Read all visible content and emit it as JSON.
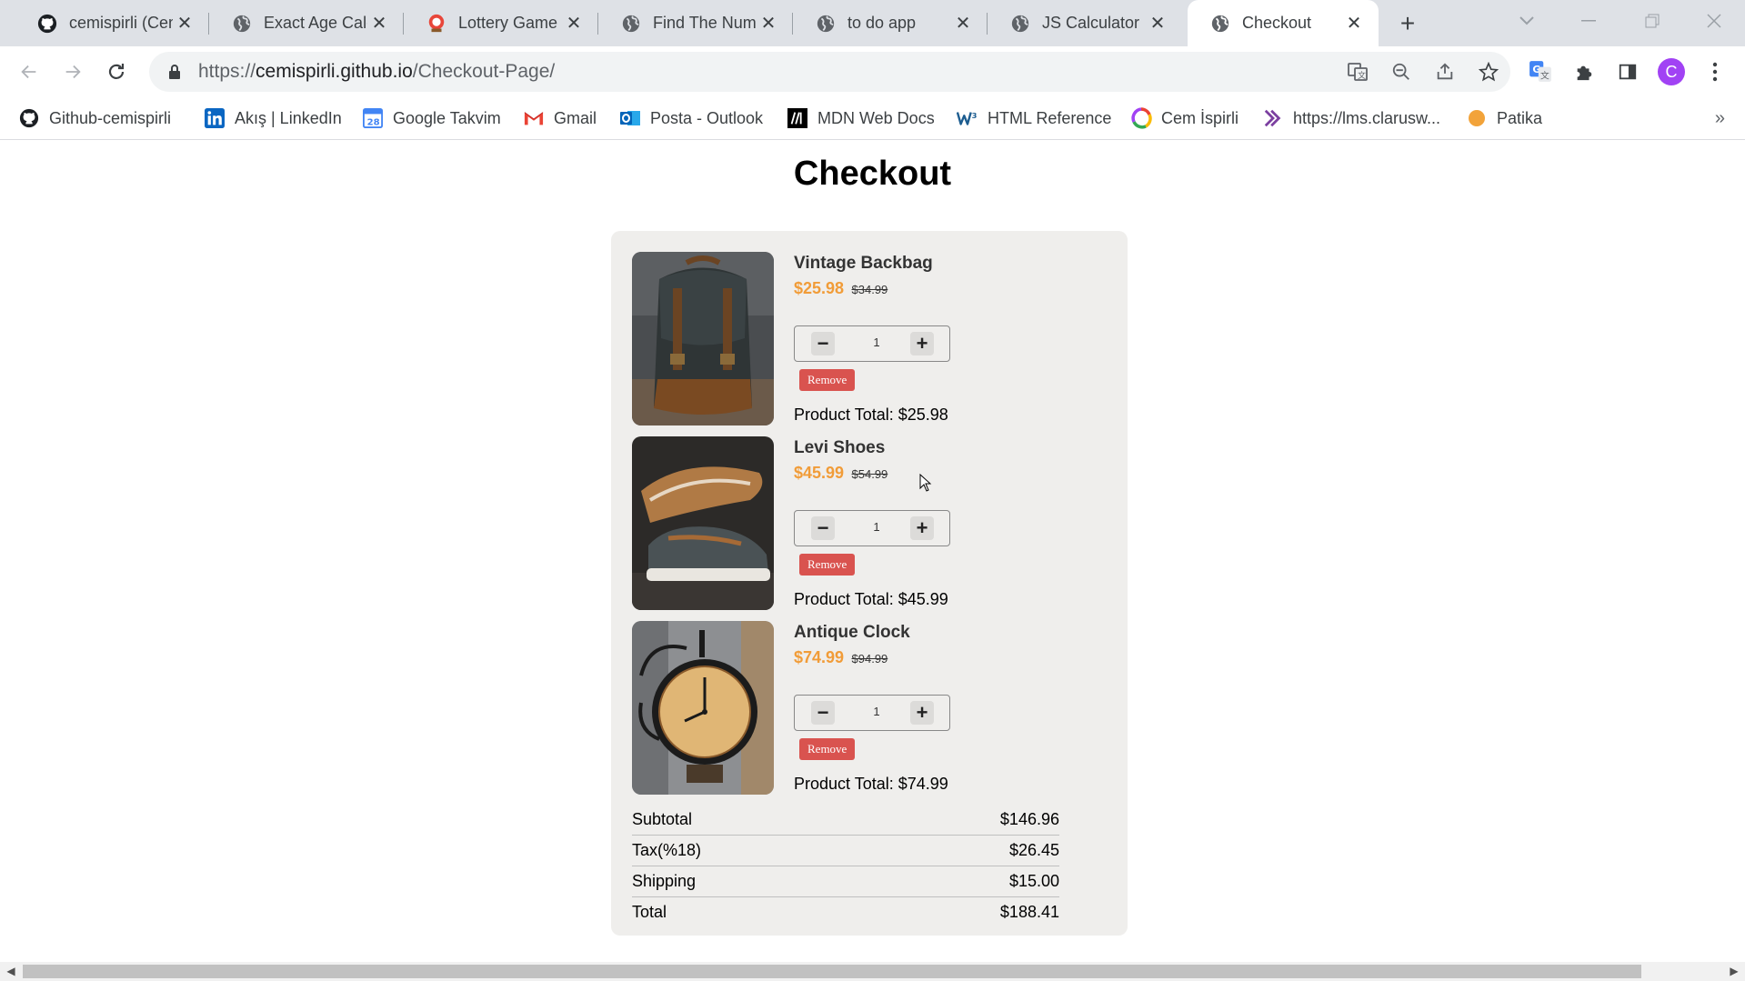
{
  "browser": {
    "tabs": [
      {
        "title": "cemispirli (Cem",
        "icon": "github-icon",
        "active": false
      },
      {
        "title": "Exact Age Calc",
        "icon": "globe-icon",
        "active": false
      },
      {
        "title": "Lottery Game",
        "icon": "lottery-icon",
        "active": false
      },
      {
        "title": "Find The Numb",
        "icon": "globe-icon",
        "active": false
      },
      {
        "title": "to do app",
        "icon": "globe-icon",
        "active": false
      },
      {
        "title": "JS Calculator",
        "icon": "globe-icon",
        "active": false
      },
      {
        "title": "Checkout",
        "icon": "globe-icon",
        "active": true
      }
    ],
    "url": {
      "scheme": "https://",
      "host": "cemispirli.github.io",
      "path": "/Checkout-Page/"
    },
    "avatar_letter": "C",
    "accent": "#a142f4",
    "bookmarks": [
      {
        "label": "Github-cemispirli",
        "icon": "github-icon"
      },
      {
        "label": "Akış | LinkedIn",
        "icon": "linkedin-icon"
      },
      {
        "label": "Google Takvim",
        "icon": "calendar-icon"
      },
      {
        "label": "Gmail",
        "icon": "gmail-icon"
      },
      {
        "label": "Posta - Outlook",
        "icon": "outlook-icon"
      },
      {
        "label": "MDN Web Docs",
        "icon": "mdn-icon"
      },
      {
        "label": "HTML Reference",
        "icon": "w3-icon"
      },
      {
        "label": "Cem İspirli",
        "icon": "swirl-icon"
      },
      {
        "label": "https://lms.clarusw...",
        "icon": "clarusway-icon"
      },
      {
        "label": "Patika",
        "icon": "patika-icon"
      }
    ],
    "calendar_icon_text": "28"
  },
  "page": {
    "title": "Checkout",
    "products": [
      {
        "name": "Vintage Backbag",
        "price": "$25.98",
        "old_price": "$34.99",
        "qty": "1",
        "remove_label": "Remove",
        "total": "Product Total: $25.98",
        "image": "backpack-image"
      },
      {
        "name": "Levi Shoes",
        "price": "$45.99",
        "old_price": "$54.99",
        "qty": "1",
        "remove_label": "Remove",
        "total": "Product Total: $45.99",
        "image": "shoes-image"
      },
      {
        "name": "Antique Clock",
        "price": "$74.99",
        "old_price": "$94.99",
        "qty": "1",
        "remove_label": "Remove",
        "total": "Product Total: $74.99",
        "image": "clock-image"
      }
    ],
    "qty_minus": "−",
    "qty_plus": "+",
    "summary": [
      {
        "label": "Subtotal",
        "value": "$146.96"
      },
      {
        "label": "Tax(%18)",
        "value": "$26.45"
      },
      {
        "label": "Shipping",
        "value": "$15.00"
      },
      {
        "label": "Total",
        "value": "$188.41"
      }
    ],
    "colors": {
      "price": "#f19c38",
      "remove": "#d9534f",
      "card": "#efeeec"
    }
  }
}
